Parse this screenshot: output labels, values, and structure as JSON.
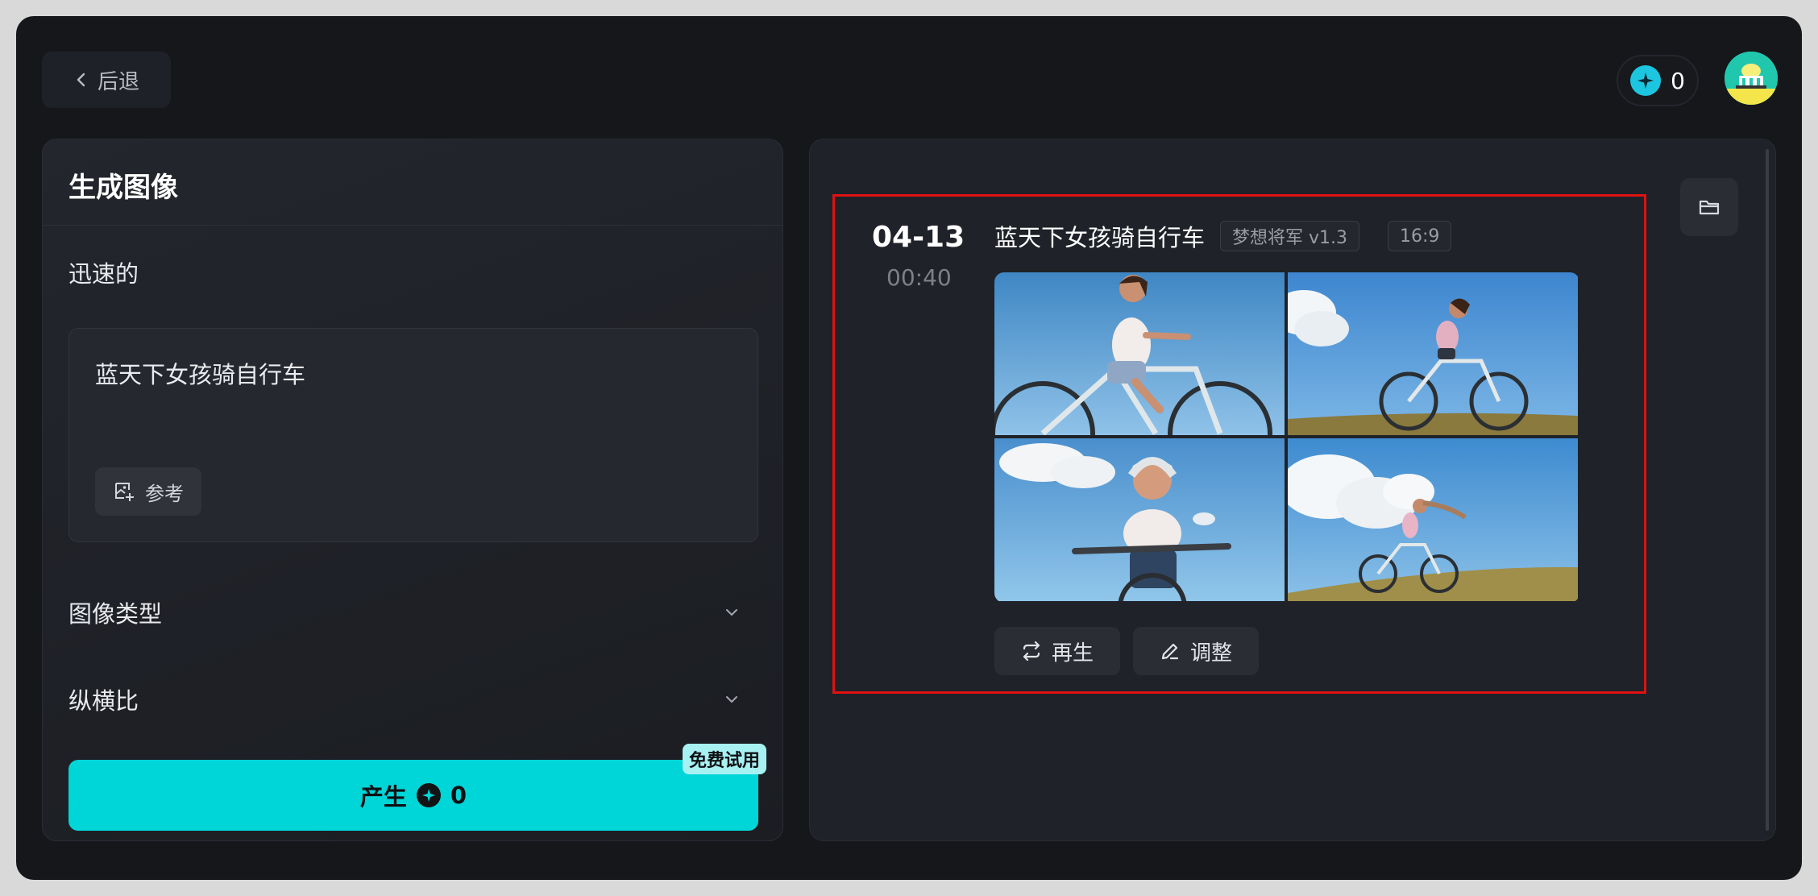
{
  "header": {
    "back_label": "后退",
    "credits": "0"
  },
  "left_panel": {
    "title": "生成图像",
    "prompt_section_label": "迅速的",
    "prompt_text": "蓝天下女孩骑自行车",
    "reference_label": "参考",
    "image_type_label": "图像类型",
    "aspect_ratio_label": "纵横比",
    "generate_label": "产生",
    "generate_cost": "0",
    "trial_badge": "免费试用"
  },
  "result": {
    "date": "04-13",
    "time": "00:40",
    "title": "蓝天下女孩骑自行车",
    "model_tag": "梦想将军 v1.3",
    "ratio_tag": "16:9",
    "regenerate_label": "再生",
    "adjust_label": "调整"
  },
  "colors": {
    "accent": "#00d5d8",
    "highlight_border": "#e01212",
    "credit_icon": "#1cc6e0",
    "background": "#15171b"
  },
  "icons": [
    "chevron-left-icon",
    "credit-icon",
    "avatar",
    "image-add-icon",
    "chevron-down-icon",
    "folder-icon",
    "refresh-icon",
    "edit-icon"
  ]
}
